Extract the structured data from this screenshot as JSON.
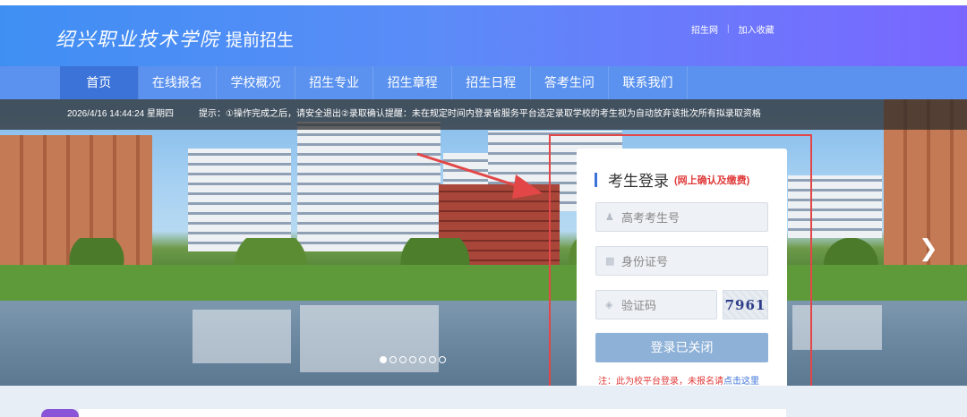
{
  "header": {
    "logo_calligraphy": "绍兴职业技术学院",
    "logo_subtitle": "提前招生",
    "links": [
      "招生网",
      "加入收藏"
    ]
  },
  "nav": {
    "items": [
      "首页",
      "在线报名",
      "学校概况",
      "招生专业",
      "招生章程",
      "招生日程",
      "答考生问",
      "联系我们"
    ],
    "active_index": 0
  },
  "notice": {
    "datetime": "2026/4/16 14:44:24 星期四",
    "message": "提示：①操作完成之后，请安全退出②录取确认提醒：未在规定时间内登录省服务平台选定录取学校的考生视为自动放弃该批次所有拟录取资格"
  },
  "login": {
    "title": "考生登录",
    "subtitle": "(网上确认及缴费)",
    "exam_id_placeholder": "高考考生号",
    "id_card_placeholder": "身份证号",
    "captcha_placeholder": "验证码",
    "captcha_code": "7961",
    "button_label": "登录已关闭",
    "note_prefix": "注：此为校平台登录，未报名请",
    "note_link": "点击这里"
  },
  "carousel": {
    "slide_count": 7,
    "active_slide": 0,
    "next_arrow": "chevron-right-icon"
  },
  "colors": {
    "header_start": "#3f8ff3",
    "header_end": "#7a66ff",
    "nav_bg": "#5b92ef",
    "nav_active": "#3b73d8",
    "annotation_red": "#e24646",
    "login_button": "#8eb1d7"
  }
}
